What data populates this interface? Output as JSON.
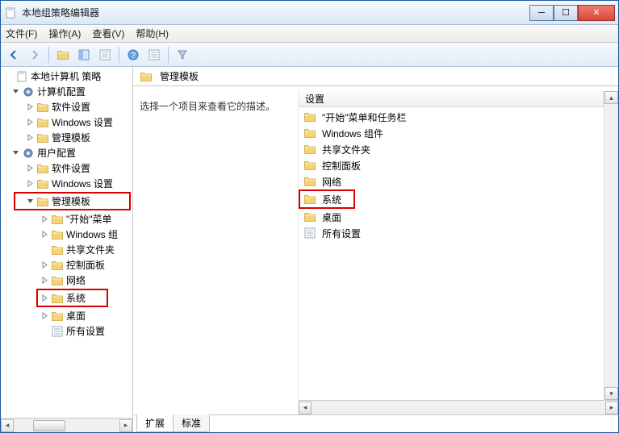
{
  "window": {
    "title": "本地组策略编辑器"
  },
  "menu": {
    "file": "文件(F)",
    "action": "操作(A)",
    "view": "查看(V)",
    "help": "帮助(H)"
  },
  "tree": {
    "root": "本地计算机 策略",
    "computer": "计算机配置",
    "c_soft": "软件设置",
    "c_win": "Windows 设置",
    "c_admin": "管理模板",
    "user": "用户配置",
    "u_soft": "软件设置",
    "u_win": "Windows 设置",
    "u_admin": "管理模板",
    "u_a_start": "\"开始\"菜单",
    "u_a_wincomp": "Windows 组",
    "u_a_share": "共享文件夹",
    "u_a_control": "控制面板",
    "u_a_net": "网络",
    "u_a_sys": "系统",
    "u_a_desktop": "桌面",
    "u_a_all": "所有设置"
  },
  "right": {
    "header": "管理模板",
    "desc": "选择一个项目来查看它的描述。",
    "colSetting": "设置",
    "items": {
      "start": "\"开始\"菜单和任务栏",
      "wincomp": "Windows 组件",
      "share": "共享文件夹",
      "control": "控制面板",
      "net": "网络",
      "sys": "系统",
      "desktop": "桌面",
      "all": "所有设置"
    }
  },
  "tabs": {
    "extended": "扩展",
    "standard": "标准"
  }
}
